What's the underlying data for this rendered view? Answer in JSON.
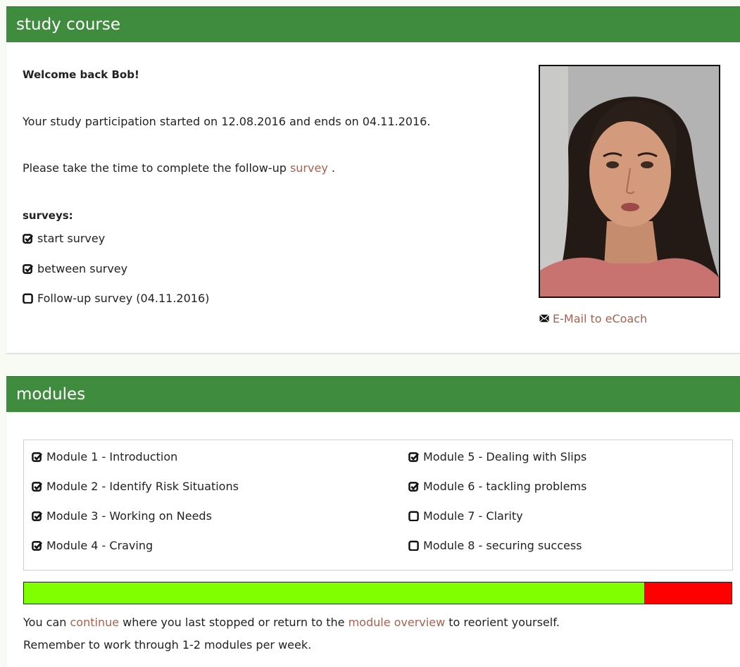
{
  "study": {
    "header": "study course",
    "welcome": "Welcome back Bob!",
    "participation": "Your study participation started on 12.08.2016 and ends on 04.11.2016.",
    "followup_before": "Please take the time to complete the follow-up ",
    "followup_link": "survey",
    "followup_after": " .",
    "surveys_label": "surveys:",
    "surveys": [
      {
        "label": "start survey",
        "done": true
      },
      {
        "label": "between survey",
        "done": true
      },
      {
        "label": "Follow-up survey (04.11.2016)",
        "done": false
      }
    ],
    "email_label": "E-Mail to eCoach",
    "email_icon": "envelope-icon"
  },
  "modules": {
    "header": "modules",
    "items": [
      {
        "label": "Module 1 - Introduction",
        "done": true
      },
      {
        "label": "Module 2 - Identify Risk Situations",
        "done": true
      },
      {
        "label": "Module 3 - Working on Needs",
        "done": true
      },
      {
        "label": "Module 4 - Craving",
        "done": true
      },
      {
        "label": "Module 5 - Dealing with Slips",
        "done": true
      },
      {
        "label": "Module 6 - tackling problems",
        "done": true
      },
      {
        "label": "Module 7 - Clarity",
        "done": false
      },
      {
        "label": "Module 8 - securing success",
        "done": false
      }
    ],
    "progress_fraction": 0.877,
    "progress_done_color": "#80ff00",
    "progress_remaining_color": "#ff0000",
    "footer_1": "You can ",
    "continue_link": "continue",
    "footer_2": " where you last stopped or return to the ",
    "overview_link": "module overview",
    "footer_3": " to reorient yourself.",
    "footer_line2": "Remember to work through 1-2 modules per week."
  },
  "colors": {
    "header_green": "#3f8c3e",
    "link": "#a8614f"
  }
}
